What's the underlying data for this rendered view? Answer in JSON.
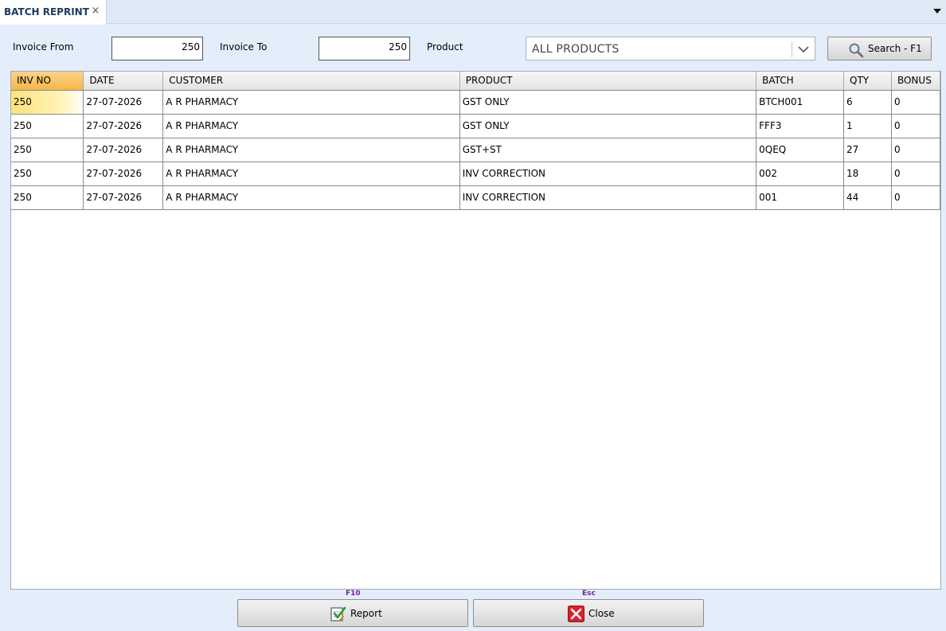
{
  "tab": {
    "title": "BATCH REPRINT",
    "close_glyph": "×"
  },
  "filters": {
    "invoice_from_label": "Invoice From",
    "invoice_from_value": "250",
    "invoice_to_label": "Invoice To",
    "invoice_to_value": "250",
    "product_label": "Product",
    "product_value": "ALL PRODUCTS",
    "search_label": "Search - F1"
  },
  "grid": {
    "columns": [
      "INV NO",
      "DATE",
      "CUSTOMER",
      "PRODUCT",
      "BATCH",
      "QTY",
      "BONUS"
    ],
    "rows": [
      [
        "250",
        "27-07-2026",
        "A R PHARMACY",
        "GST ONLY",
        "BTCH001",
        "6",
        "0"
      ],
      [
        "250",
        "27-07-2026",
        "A R PHARMACY",
        "GST ONLY",
        "FFF3",
        "1",
        "0"
      ],
      [
        "250",
        "27-07-2026",
        "A R PHARMACY",
        "GST+ST",
        "0QEQ",
        "27",
        "0"
      ],
      [
        "250",
        "27-07-2026",
        "A R PHARMACY",
        "INV CORRECTION",
        "002",
        "18",
        "0"
      ],
      [
        "250",
        "27-07-2026",
        "A R PHARMACY",
        "INV CORRECTION",
        "001",
        "44",
        "0"
      ]
    ]
  },
  "footer": {
    "report_shortcut": "F10",
    "report_label": "Report",
    "close_shortcut": "Esc",
    "close_label": "Close"
  },
  "colors": {
    "active_header": "#f6b648",
    "selected_cell": "#ffe27a",
    "background": "#e3eefa",
    "tab_text": "#1d3a5f",
    "shortcut_text": "#7a1fa2"
  },
  "icons": {
    "search": "magnifier-icon",
    "report": "report-check-icon",
    "close": "red-x-close-icon",
    "combo": "chevron-down-icon",
    "tab_menu": "dropdown-triangle-icon"
  }
}
